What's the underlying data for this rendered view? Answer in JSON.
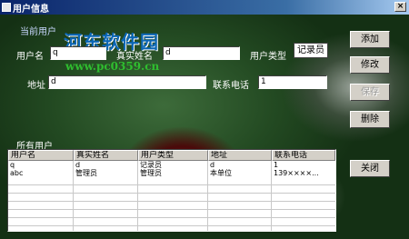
{
  "window": {
    "title": "用户信息",
    "close_glyph": "×"
  },
  "watermark": {
    "text": "河东软件园",
    "url": "www.pc0359.cn"
  },
  "form": {
    "group_label": "当前用户",
    "username_label": "用户名",
    "username_value": "q",
    "realname_label": "真实姓名",
    "realname_value": "d",
    "usertype_label": "用户类型",
    "usertype_value": "记录员",
    "address_label": "地址",
    "address_value": "d",
    "phone_label": "联系电话",
    "phone_value": "1"
  },
  "buttons": {
    "add": "添加",
    "edit": "修改",
    "save": "保存",
    "delete": "删除",
    "close": "关闭"
  },
  "list": {
    "label": "所有用户",
    "columns": [
      "用户名",
      "真实姓名",
      "用户类型",
      "地址",
      "联系电话"
    ],
    "rows": [
      [
        "q",
        "d",
        "记录员",
        "d",
        "1"
      ],
      [
        "abc",
        "管理员",
        "管理员",
        "本单位",
        "139××××..."
      ]
    ]
  }
}
